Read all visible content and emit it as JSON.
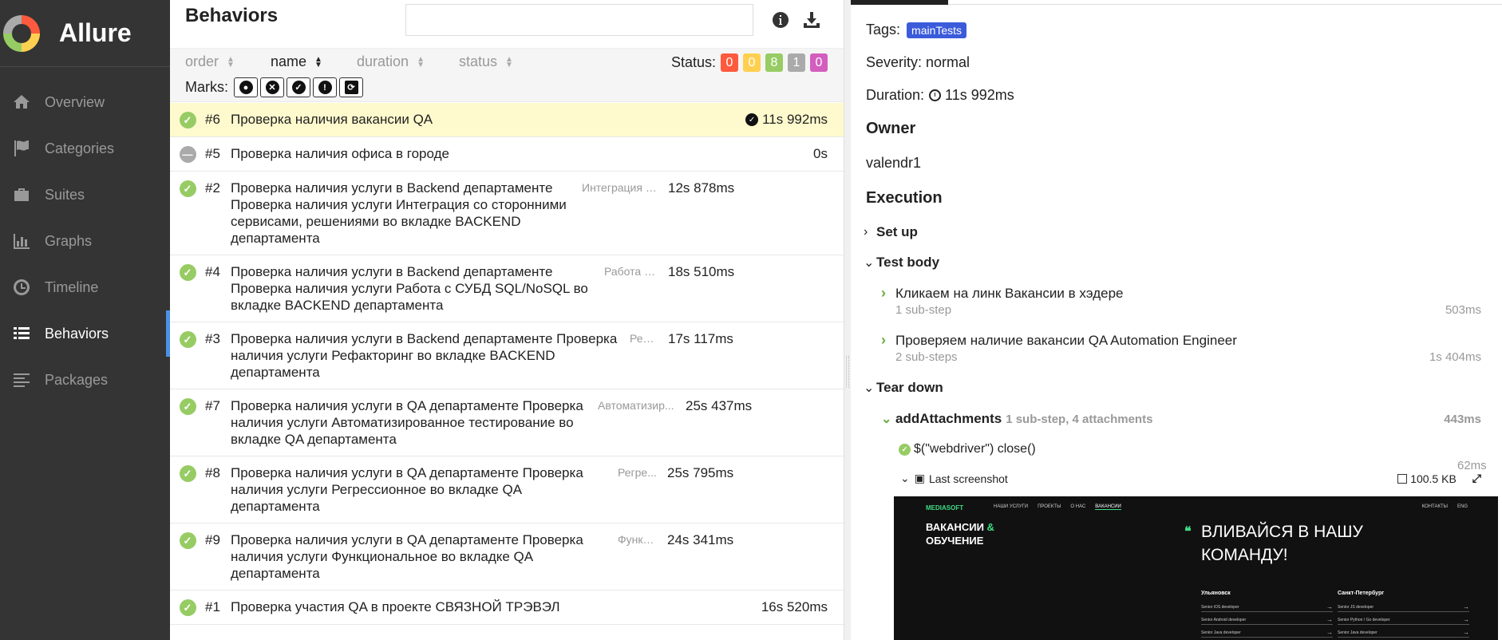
{
  "app": {
    "title": "Allure"
  },
  "sidebar": {
    "items": [
      {
        "label": "Overview",
        "icon": "home-icon"
      },
      {
        "label": "Categories",
        "icon": "flag-icon"
      },
      {
        "label": "Suites",
        "icon": "briefcase-icon"
      },
      {
        "label": "Graphs",
        "icon": "bar-chart-icon"
      },
      {
        "label": "Timeline",
        "icon": "clock-icon"
      },
      {
        "label": "Behaviors",
        "icon": "list-icon",
        "active": true
      },
      {
        "label": "Packages",
        "icon": "align-left-icon"
      }
    ]
  },
  "behaviors": {
    "title": "Behaviors",
    "search": {
      "value": "",
      "placeholder": ""
    },
    "sort": {
      "order": "order",
      "name": "name",
      "duration": "duration",
      "status": "status"
    },
    "status_label": "Status:",
    "status_counts": [
      {
        "count": "0",
        "color": "#fd5a3e"
      },
      {
        "count": "0",
        "color": "#ffd050"
      },
      {
        "count": "8",
        "color": "#97cc64"
      },
      {
        "count": "1",
        "color": "#aaaaaa"
      },
      {
        "count": "0",
        "color": "#d35ebe"
      }
    ],
    "marks_label": "Marks:",
    "rows": [
      {
        "num": "#6",
        "title": "Проверка наличия вакансии QA",
        "tag": "",
        "duration": "11s 992ms",
        "status": "passed",
        "selected": true
      },
      {
        "num": "#5",
        "title": "Проверка наличия офиса в городе",
        "tag": "",
        "duration": "0s",
        "status": "skipped"
      },
      {
        "num": "#2",
        "title": "Проверка наличия услуги в Backend департаменте Проверка наличия услуги Интеграция со сторонними сервисами, решениями во вкладке BACKEND департамента",
        "tag": "Интеграция со с...",
        "duration": "12s 878ms",
        "status": "passed"
      },
      {
        "num": "#4",
        "title": "Проверка наличия услуги в Backend департаменте Проверка наличия услуги Работа с СУБД SQL/NoSQL во вкладке BACKEND департамента",
        "tag": "Работа с ...",
        "duration": "18s 510ms",
        "status": "passed"
      },
      {
        "num": "#3",
        "title": "Проверка наличия услуги в Backend департаменте Проверка наличия услуги Рефакторинг во вкладке BACKEND департамента",
        "tag": "Реф...",
        "duration": "17s 117ms",
        "status": "passed"
      },
      {
        "num": "#7",
        "title": "Проверка наличия услуги в QA департаменте Проверка наличия услуги Автоматизированное тестирование во вкладке QA департамента",
        "tag": "Автоматизир...",
        "duration": "25s 437ms",
        "status": "passed"
      },
      {
        "num": "#8",
        "title": "Проверка наличия услуги в QA департаменте Проверка наличия услуги Регрессионное во вкладке QA департамента",
        "tag": "Регре...",
        "duration": "25s 795ms",
        "status": "passed"
      },
      {
        "num": "#9",
        "title": "Проверка наличия услуги в QA департаменте Проверка наличия услуги Функциональное во вкладке QA департамента",
        "tag": "Функци...",
        "duration": "24s 341ms",
        "status": "passed"
      },
      {
        "num": "#1",
        "title": "Проверка участия QA в проекте СВЯЗНОЙ ТРЭВЭЛ",
        "tag": "",
        "duration": "16s 520ms",
        "status": "passed"
      }
    ]
  },
  "details": {
    "tags_label": "Tags:",
    "tag": "mainTests",
    "severity": "Severity: normal",
    "duration_label": "Duration:",
    "duration": "11s 992ms",
    "owner_title": "Owner",
    "owner": "valendr1",
    "execution_title": "Execution",
    "setup": "Set up",
    "test_body": "Test body",
    "steps": [
      {
        "title": "Кликаем на линк Вакансии в хэдере",
        "sub": "1 sub-step",
        "duration": "503ms"
      },
      {
        "title": "Проверяем наличие вакансии QA Automation Engineer",
        "sub": "2 sub-steps",
        "duration": "1s 404ms"
      }
    ],
    "teardown": "Tear down",
    "attachment_step": {
      "title": "addAttachments",
      "meta": "1 sub-step, 4 attachments",
      "duration": "443ms"
    },
    "sub_step": "$(\"webdriver\") close()",
    "sub_step_duration": "62ms",
    "screenshot": {
      "label": "Last screenshot",
      "size": "100.5 KB"
    },
    "preview": {
      "logo": "MEDIASOFT",
      "nav": [
        "НАШИ УСЛУГИ",
        "ПРОЕКТЫ",
        "О НАС",
        "ВАКАНСИИ"
      ],
      "nav_right": [
        "КОНТАКТЫ",
        "ENG"
      ],
      "heading_a": "ВАКАНСИИ",
      "heading_amp": "&",
      "heading_b": "ОБУЧЕНИЕ",
      "slogan": "ВЛИВАЙСЯ В НАШУ КОМАНДУ!",
      "city_1": "Ульяновск",
      "city_2": "Санкт-Петербург",
      "jobs_1": [
        "Senior iOS developer",
        "Senior Android developer",
        "Senior Java developer"
      ],
      "jobs_2": [
        "Senior JS developer",
        "Senior Python / Go developer",
        "Senior Java developer"
      ]
    }
  }
}
